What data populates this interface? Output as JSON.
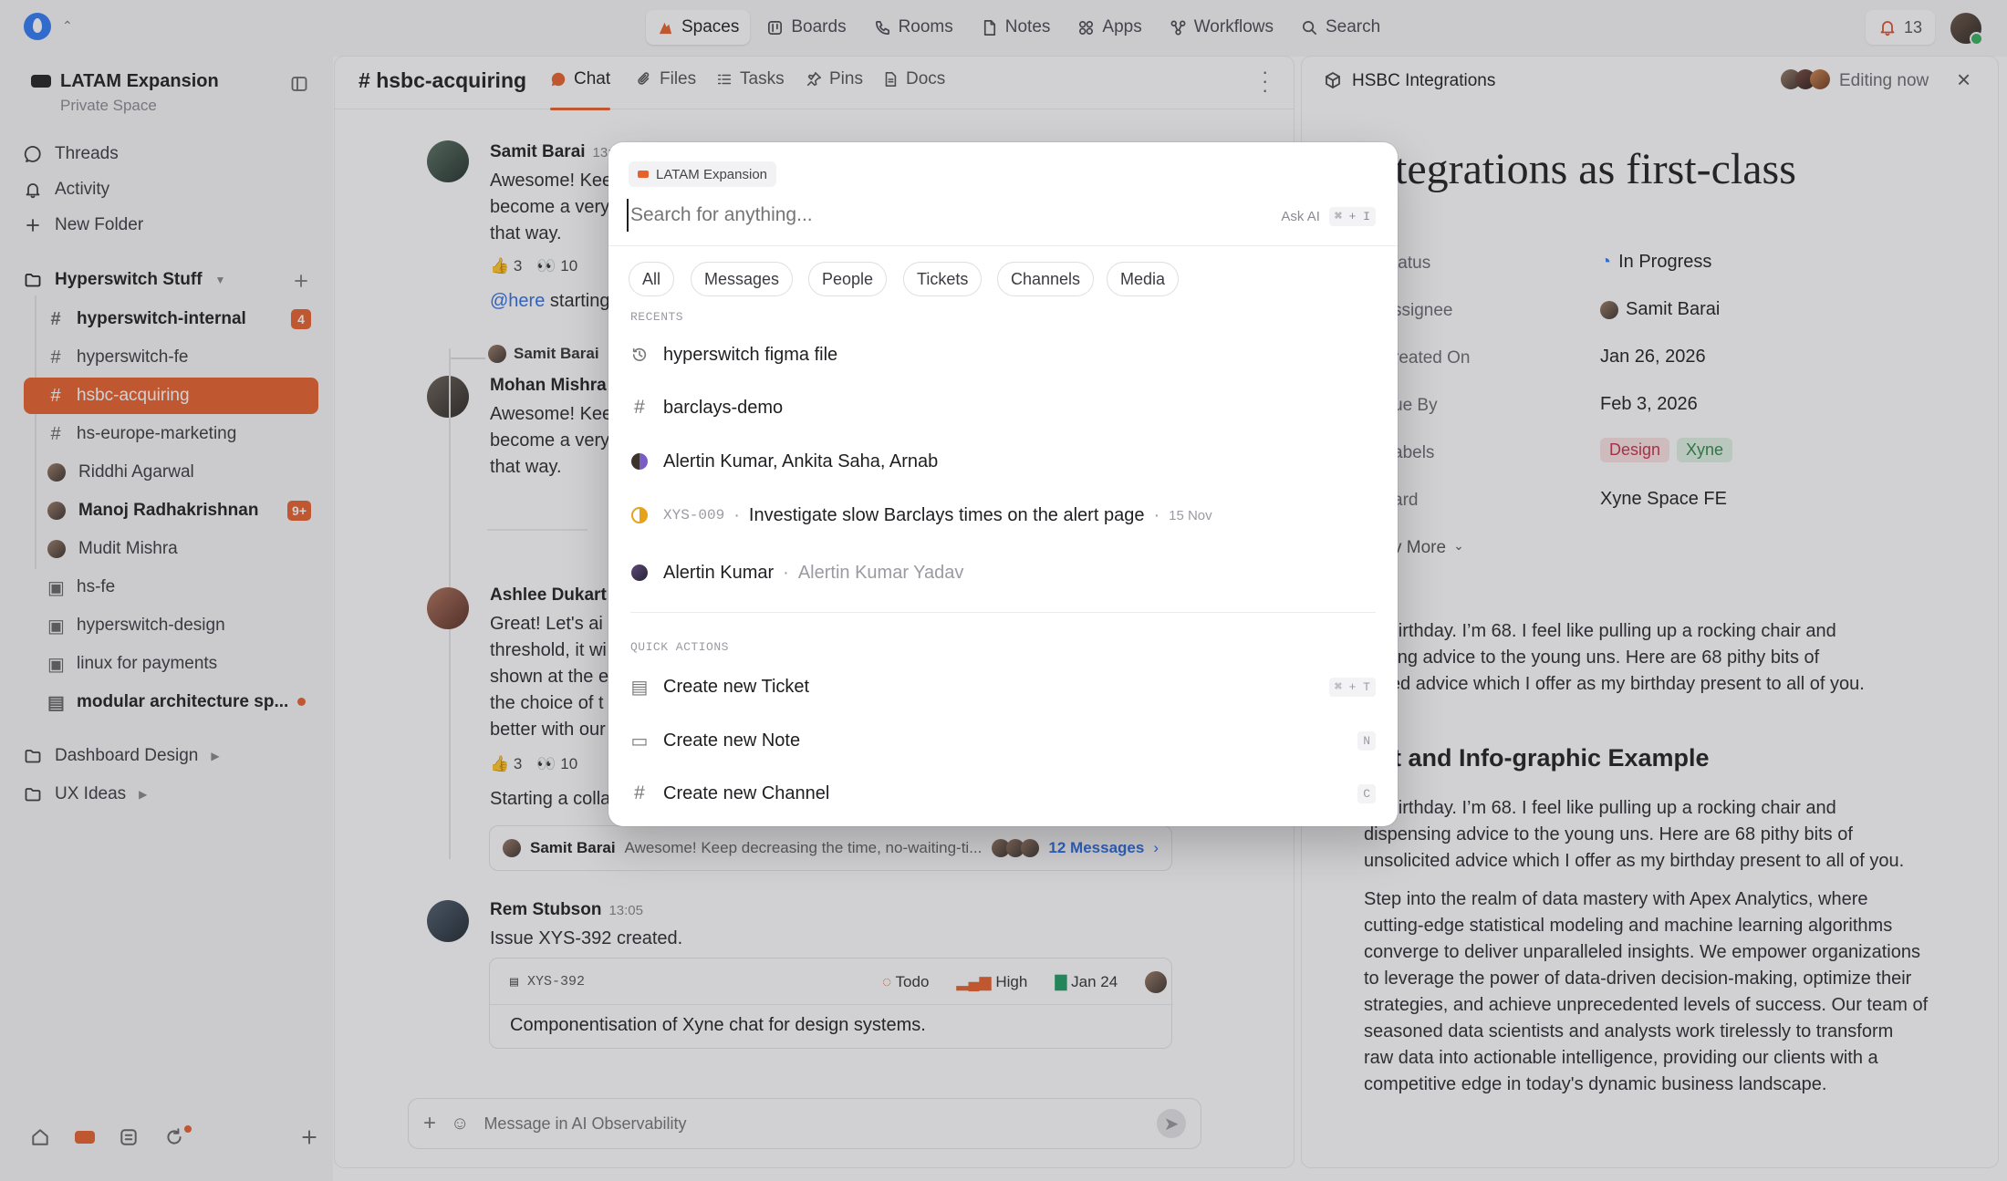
{
  "topbar": {
    "nav": [
      {
        "label": "Spaces",
        "icon": "spaces-icon",
        "active": true
      },
      {
        "label": "Boards",
        "icon": "boards-icon"
      },
      {
        "label": "Rooms",
        "icon": "rooms-icon"
      },
      {
        "label": "Notes",
        "icon": "notes-icon"
      },
      {
        "label": "Apps",
        "icon": "apps-icon"
      },
      {
        "label": "Workflows",
        "icon": "workflows-icon"
      },
      {
        "label": "Search",
        "icon": "search-icon"
      }
    ],
    "notifications": "13"
  },
  "sidebar": {
    "space_title": "LATAM Expansion",
    "space_subtitle": "Private Space",
    "top_items": [
      "Threads",
      "Activity",
      "New Folder"
    ],
    "folder": "Hyperswitch Stuff",
    "channels": [
      {
        "label": "hyperswitch-internal",
        "badge": "4"
      },
      {
        "label": "hyperswitch-fe"
      },
      {
        "label": "hsbc-acquiring"
      },
      {
        "label": "hs-europe-marketing"
      },
      {
        "label": "Riddhi Agarwal"
      },
      {
        "label": "Manoj Radhakrishnan",
        "badge": "9+"
      },
      {
        "label": "Mudit Mishra"
      },
      {
        "label": "hs-fe"
      },
      {
        "label": "hyperswitch-design"
      },
      {
        "label": "linux for payments"
      },
      {
        "label": "modular architecture sp..."
      }
    ],
    "folders_bottom": [
      "Dashboard Design",
      "UX Ideas"
    ]
  },
  "chat": {
    "channel": "hsbc-acquiring",
    "tabs": [
      "Chat",
      "Files",
      "Tasks",
      "Pins",
      "Docs"
    ],
    "messages": {
      "m1": {
        "name": "Samit Barai",
        "time": "13:0",
        "lines": [
          "Awesome! Kee",
          "become a very",
          "that way."
        ],
        "r1": "👍 3",
        "r2": "👀 10",
        "mention": "@here",
        "mention_text": "starting"
      },
      "reply": {
        "name": "Samit Barai"
      },
      "m2": {
        "name": "Mohan Mishra",
        "lines": [
          "Awesome! Kee",
          "become a very",
          "that way."
        ]
      },
      "m3": {
        "name": "Ashlee Dukart",
        "lines": [
          "Great! Let's ai",
          "threshold, it wi",
          "shown at the e",
          "the choice of t",
          "better with our"
        ],
        "r1": "👍 3",
        "r2": "👀 10",
        "tail": "Starting a colla"
      },
      "thread": {
        "name": "Samit Barai",
        "text": "Awesome! Keep decreasing the time, no-waiting-ti...",
        "count": "12 Messages"
      },
      "m4": {
        "name": "Rem Stubson",
        "time": "13:05",
        "text": "Issue XYS-392 created."
      },
      "issue": {
        "id": "XYS-392",
        "status": "Todo",
        "priority": "High",
        "date": "Jan 24",
        "title": "Componentisation of Xyne chat for design systems."
      }
    },
    "composer_placeholder": "Message in AI Observability"
  },
  "doc": {
    "title": "HSBC Integrations",
    "editing": "Editing now",
    "heading": "tegrations as first-class",
    "props": [
      {
        "k": "tatus",
        "v": "In Progress"
      },
      {
        "k": "ssignee",
        "v": "Samit Barai"
      },
      {
        "k": "reated On",
        "v": "Jan 26, 2026"
      },
      {
        "k": "ue By",
        "v": "Feb 3, 2026"
      },
      {
        "k": "abels",
        "v": ""
      },
      {
        "k": "ard",
        "v": "Xyne Space FE"
      }
    ],
    "labels": [
      "Design",
      "Xyne"
    ],
    "show_more": "v More",
    "para1": [
      "ny birthday. I’m 68. I feel like pulling up a rocking chair and",
      "ensing advice to the young uns. Here are 68 pithy bits of",
      "licited advice which I offer as my birthday present to all of you."
    ],
    "subheading": "t and Info-graphic Example",
    "para2": [
      "ny birthday. I’m 68. I feel like pulling up a rocking chair and",
      "dispensing advice to the young uns. Here are 68 pithy bits of",
      "unsolicited advice which I offer as my birthday present to all of you."
    ],
    "para3": [
      "Step into the realm of data mastery with Apex Analytics, where",
      "cutting-edge statistical modeling and machine learning algorithms",
      "converge to deliver unparalleled insights. We empower organizations",
      "to leverage the power of data-driven decision-making, optimize their",
      "strategies, and achieve unprecedented levels of success. Our team of",
      "seasoned data scientists and analysts work tirelessly to transform",
      "raw data into actionable intelligence, providing our clients with a",
      "competitive edge in today's dynamic business landscape."
    ]
  },
  "palette": {
    "scope": "LATAM Expansion",
    "placeholder": "Search for anything...",
    "ask_ai": "Ask AI",
    "ask_ai_kbd": "⌘ + I",
    "filters": [
      "All",
      "Messages",
      "People",
      "Tickets",
      "Channels",
      "Media"
    ],
    "recents_label": "RECENTS",
    "recents": [
      {
        "text": "hyperswitch figma file"
      },
      {
        "text": "barclays-demo"
      },
      {
        "text": "Alertin Kumar, Ankita Saha, Arnab"
      },
      {
        "id": "XYS-009",
        "text": "Investigate slow Barclays times on the alert page",
        "date": "15 Nov"
      },
      {
        "text": "Alertin Kumar",
        "sub": "Alertin Kumar Yadav"
      }
    ],
    "quick_label": "QUICK ACTIONS",
    "actions": [
      {
        "text": "Create new Ticket",
        "kbd": "⌘ + T"
      },
      {
        "text": "Create new Note",
        "kbd": "N"
      },
      {
        "text": "Create new Channel",
        "kbd": "C"
      }
    ]
  },
  "colors": {
    "accent": "#e8612c",
    "link": "#2f6fe4",
    "brand": "#2f7cf6"
  }
}
